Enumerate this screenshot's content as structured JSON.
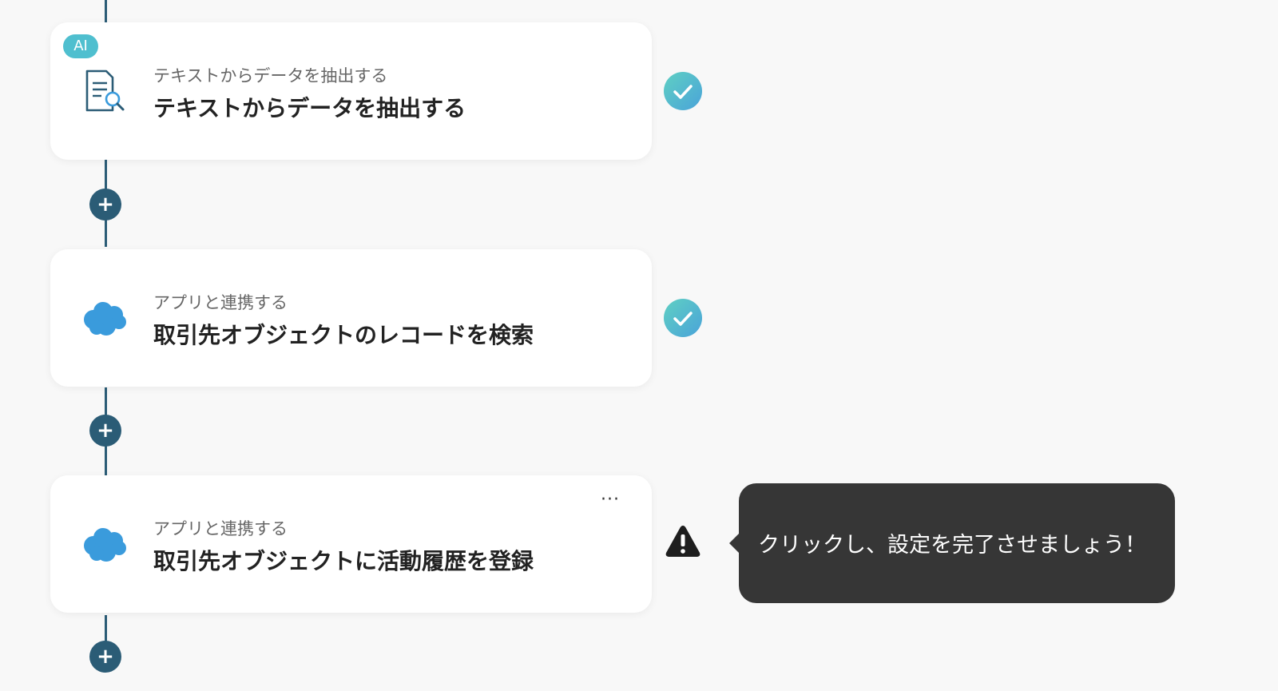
{
  "flow": {
    "steps": [
      {
        "badge": "AI",
        "subtitle": "テキストからデータを抽出する",
        "title": "テキストからデータを抽出する",
        "icon": "document-search-icon",
        "status": "complete"
      },
      {
        "subtitle": "アプリと連携する",
        "title": "取引先オブジェクトのレコードを検索",
        "icon": "salesforce-cloud-icon",
        "status": "complete"
      },
      {
        "subtitle": "アプリと連携する",
        "title": "取引先オブジェクトに活動履歴を登録",
        "icon": "salesforce-cloud-icon",
        "status": "warning",
        "menu": "···"
      }
    ],
    "add_step_symbol": "+"
  },
  "tooltip": {
    "text": "クリックし、設定を完了させましょう！"
  },
  "colors": {
    "connector": "#2b5c76",
    "badge": "#4fbfcf",
    "check_gradient_start": "#5fd0c3",
    "check_gradient_end": "#4aa3d9",
    "salesforce": "#3a9bdc",
    "tooltip_bg": "#363636",
    "warning": "#1e1e1e"
  }
}
